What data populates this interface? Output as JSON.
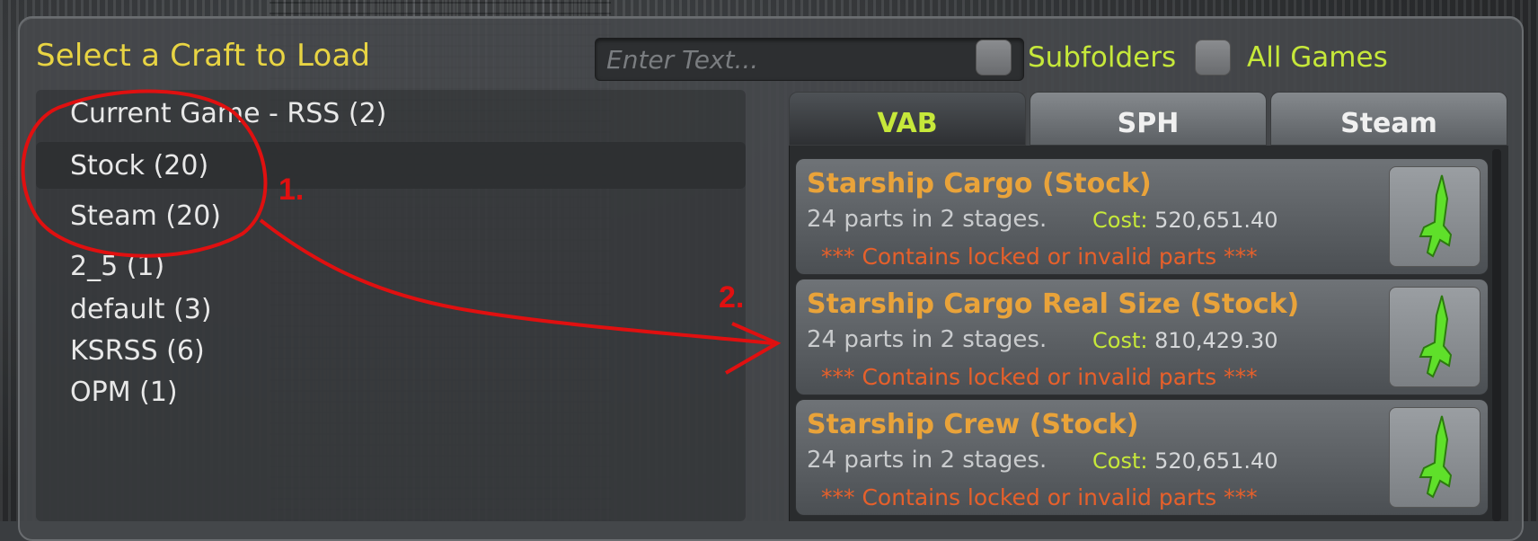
{
  "dialog": {
    "title": "Select a Craft to Load",
    "search_placeholder": "Enter Text...",
    "subfolders_label": "Subfolders",
    "all_games_label": "All Games"
  },
  "folders": [
    {
      "label": "Current Game - RSS (2)",
      "selected": false
    },
    {
      "label": "Stock (20)",
      "selected": true
    },
    {
      "label": "Steam (20)",
      "selected": false
    },
    {
      "label": "2_5 (1)",
      "selected": false
    },
    {
      "label": "default (3)",
      "selected": false
    },
    {
      "label": "KSRSS (6)",
      "selected": false
    },
    {
      "label": "OPM (1)",
      "selected": false
    }
  ],
  "tabs": [
    {
      "label": "VAB",
      "active": true
    },
    {
      "label": "SPH",
      "active": false
    },
    {
      "label": "Steam",
      "active": false
    }
  ],
  "crafts": [
    {
      "name": "Starship Cargo (Stock)",
      "info": "24 parts in 2 stages.",
      "cost_label": "Cost:",
      "cost": "520,651.40",
      "warning": "*** Contains locked or invalid parts ***",
      "icon": "rocket-icon"
    },
    {
      "name": "Starship Cargo Real Size (Stock)",
      "info": "24 parts in 2 stages.",
      "cost_label": "Cost:",
      "cost": "810,429.30",
      "warning": "*** Contains locked or invalid parts ***",
      "icon": "rocket-icon"
    },
    {
      "name": "Starship Crew (Stock)",
      "info": "24 parts in 2 stages.",
      "cost_label": "Cost:",
      "cost": "520,651.40",
      "warning": "*** Contains locked or invalid parts ***",
      "icon": "rocket-icon"
    }
  ],
  "annotations": {
    "step1": "1.",
    "step2": "2.",
    "color": "#e01010"
  },
  "colors": {
    "title": "#e8d443",
    "accent_green": "#c6e83a",
    "craft_name": "#e9a33a",
    "warning": "#e6602b"
  }
}
